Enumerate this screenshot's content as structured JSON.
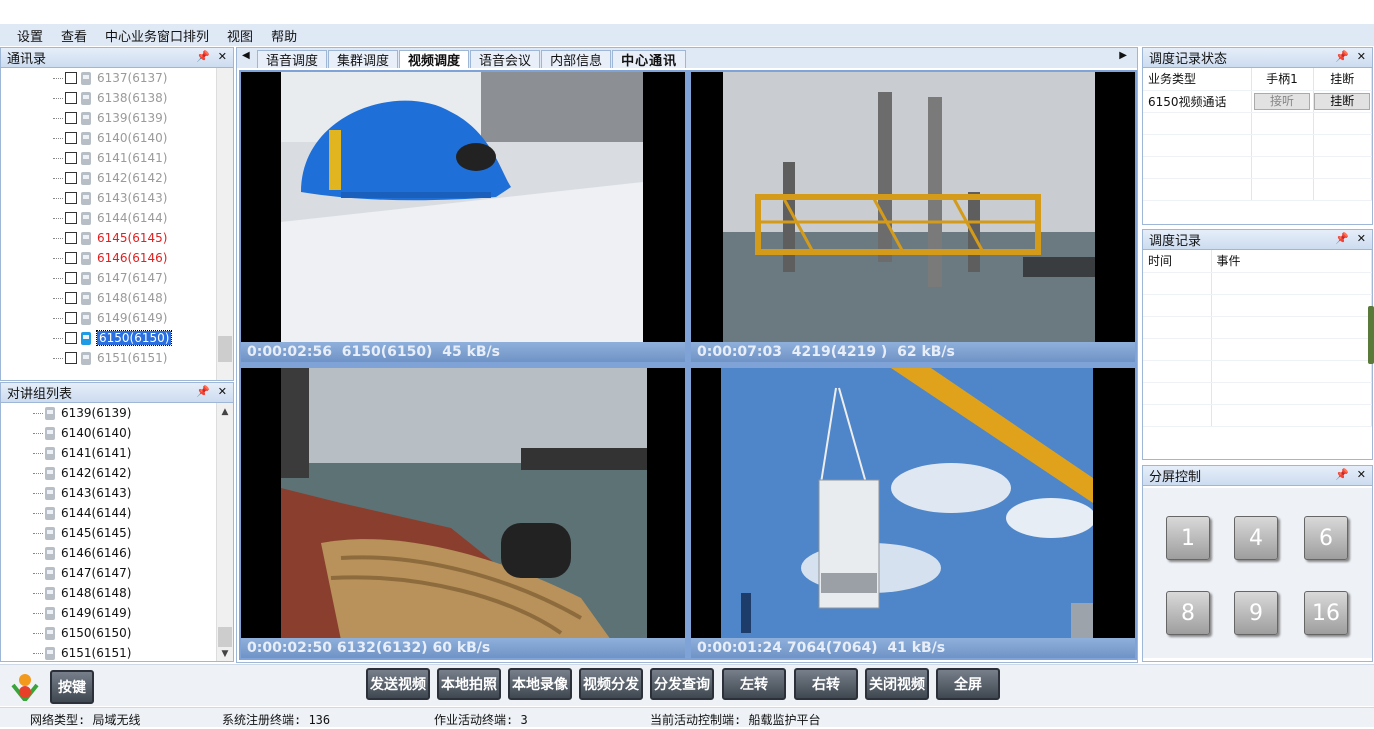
{
  "menu": [
    "设置",
    "查看",
    "中心业务窗口排列",
    "视图",
    "帮助"
  ],
  "contacts_panel": {
    "title": "通讯录",
    "items": [
      {
        "label": "6137(6137)",
        "color": "#9a9a9a",
        "selected": false
      },
      {
        "label": "6138(6138)",
        "color": "#9a9a9a",
        "selected": false
      },
      {
        "label": "6139(6139)",
        "color": "#9a9a9a",
        "selected": false
      },
      {
        "label": "6140(6140)",
        "color": "#9a9a9a",
        "selected": false
      },
      {
        "label": "6141(6141)",
        "color": "#9a9a9a",
        "selected": false
      },
      {
        "label": "6142(6142)",
        "color": "#9a9a9a",
        "selected": false
      },
      {
        "label": "6143(6143)",
        "color": "#9a9a9a",
        "selected": false
      },
      {
        "label": "6144(6144)",
        "color": "#9a9a9a",
        "selected": false
      },
      {
        "label": "6145(6145)",
        "color": "#e02020",
        "selected": false
      },
      {
        "label": "6146(6146)",
        "color": "#e02020",
        "selected": false
      },
      {
        "label": "6147(6147)",
        "color": "#9a9a9a",
        "selected": false
      },
      {
        "label": "6148(6148)",
        "color": "#9a9a9a",
        "selected": false
      },
      {
        "label": "6149(6149)",
        "color": "#9a9a9a",
        "selected": false
      },
      {
        "label": "6150(6150)",
        "color": "#e02020",
        "selected": true
      },
      {
        "label": "6151(6151)",
        "color": "#9a9a9a",
        "selected": false
      }
    ]
  },
  "group_panel": {
    "title": "对讲组列表",
    "items": [
      "6139(6139)",
      "6140(6140)",
      "6141(6141)",
      "6142(6142)",
      "6143(6143)",
      "6144(6144)",
      "6145(6145)",
      "6146(6146)",
      "6147(6147)",
      "6148(6148)",
      "6149(6149)",
      "6150(6150)",
      "6151(6151)"
    ]
  },
  "tabs": [
    "语音调度",
    "集群调度",
    "视频调度",
    "语音会议",
    "内部信息",
    "中心通讯"
  ],
  "active_tab": "视频调度",
  "videos": [
    {
      "caption": "0:00:02:56  6150(6150)  45 kB/s"
    },
    {
      "caption": "0:00:07:03  4219(4219 )  62 kB/s"
    },
    {
      "caption": "0:00:02:50 6132(6132) 60 kB/s"
    },
    {
      "caption": "0:00:01:24 7064(7064)  41 kB/s"
    }
  ],
  "dispatch_status": {
    "title": "调度记录状态",
    "headers": [
      "业务类型",
      "手柄1",
      "挂断"
    ],
    "row": {
      "type": "6150视频通话",
      "answer": "接听",
      "hangup": "挂断"
    }
  },
  "dispatch_log": {
    "title": "调度记录",
    "headers": [
      "时间",
      "事件"
    ]
  },
  "split_control": {
    "title": "分屏控制",
    "buttons": [
      "1",
      "4",
      "6",
      "8",
      "9",
      "16"
    ]
  },
  "key_button": "按键",
  "actions": [
    "发送视频",
    "本地拍照",
    "本地录像",
    "视频分发",
    "分发查询",
    "左转",
    "右转",
    "关闭视频",
    "全屏"
  ],
  "status": {
    "network": "网络类型: 局域无线",
    "registered": "系统注册终端: 136",
    "active": "作业活动终端: 3",
    "controller": "当前活动控制端: 船载监护平台"
  }
}
